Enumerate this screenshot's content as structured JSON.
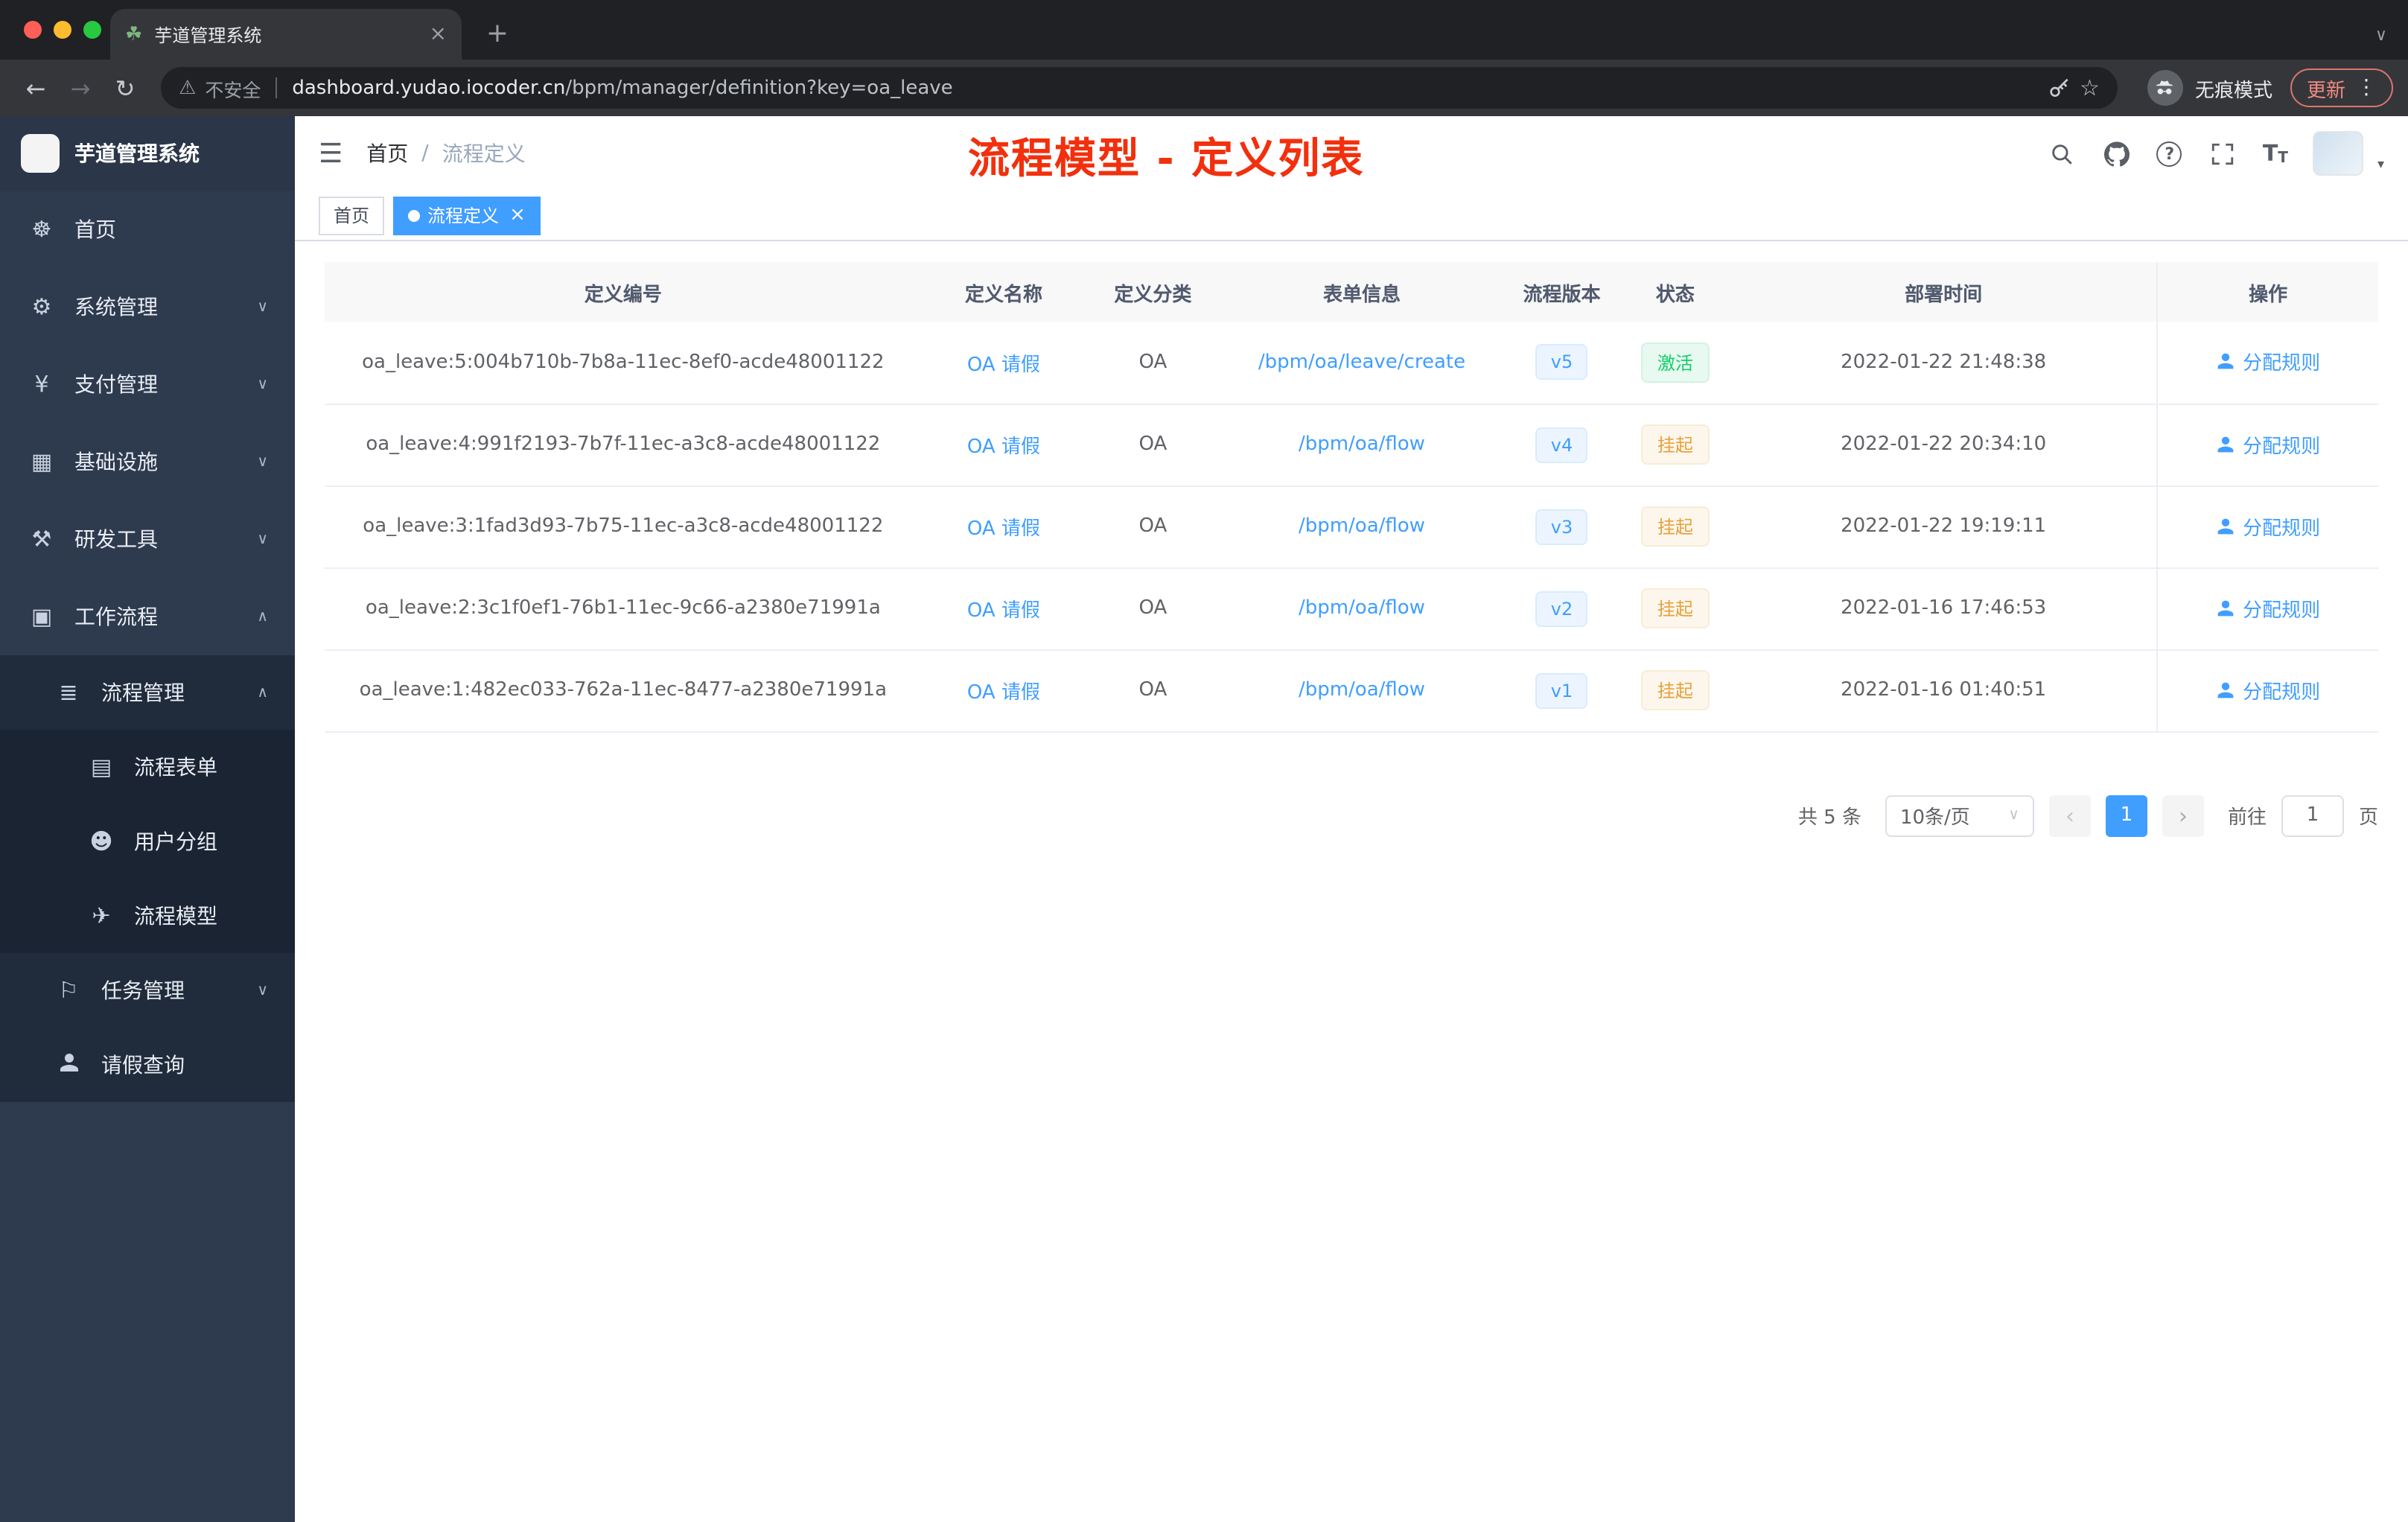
{
  "browser": {
    "tab_title": "芋道管理系统",
    "security_label": "不安全",
    "url_host": "dashboard.yudao.iocoder.cn",
    "url_path": "/bpm/manager/definition?key=oa_leave",
    "incognito_label": "无痕模式",
    "update_label": "更新"
  },
  "sidebar": {
    "app_title": "芋道管理系统",
    "items": [
      {
        "label": "首页",
        "icon": "☸"
      },
      {
        "label": "系统管理",
        "icon": "⚙"
      },
      {
        "label": "支付管理",
        "icon": "¥"
      },
      {
        "label": "基础设施",
        "icon": "▦"
      },
      {
        "label": "研发工具",
        "icon": "⚒"
      },
      {
        "label": "工作流程",
        "icon": "▣"
      },
      {
        "label": "流程管理",
        "icon": "≣"
      },
      {
        "label": "流程表单",
        "icon": "▤"
      },
      {
        "label": "用户分组",
        "icon": "☻"
      },
      {
        "label": "流程模型",
        "icon": "✈"
      },
      {
        "label": "任务管理",
        "icon": "⚐"
      },
      {
        "label": "请假查询",
        "icon": ""
      }
    ]
  },
  "header": {
    "breadcrumb_home": "首页",
    "breadcrumb_sep": "/",
    "breadcrumb_current": "流程定义",
    "annotation": "流程模型 - 定义列表"
  },
  "tags": {
    "home": "首页",
    "active": "流程定义"
  },
  "table": {
    "columns": [
      "定义编号",
      "定义名称",
      "定义分类",
      "表单信息",
      "流程版本",
      "状态",
      "部署时间",
      "操作"
    ],
    "rows": [
      {
        "id": "oa_leave:5:004b710b-7b8a-11ec-8ef0-acde48001122",
        "name": "OA 请假",
        "category": "OA",
        "form": "/bpm/oa/leave/create",
        "version": "v5",
        "status": "激活",
        "time": "2022-01-22 21:48:38",
        "action": "分配规则"
      },
      {
        "id": "oa_leave:4:991f2193-7b7f-11ec-a3c8-acde48001122",
        "name": "OA 请假",
        "category": "OA",
        "form": "/bpm/oa/flow",
        "version": "v4",
        "status": "挂起",
        "time": "2022-01-22 20:34:10",
        "action": "分配规则"
      },
      {
        "id": "oa_leave:3:1fad3d93-7b75-11ec-a3c8-acde48001122",
        "name": "OA 请假",
        "category": "OA",
        "form": "/bpm/oa/flow",
        "version": "v3",
        "status": "挂起",
        "time": "2022-01-22 19:19:11",
        "action": "分配规则"
      },
      {
        "id": "oa_leave:2:3c1f0ef1-76b1-11ec-9c66-a2380e71991a",
        "name": "OA 请假",
        "category": "OA",
        "form": "/bpm/oa/flow",
        "version": "v2",
        "status": "挂起",
        "time": "2022-01-16 17:46:53",
        "action": "分配规则"
      },
      {
        "id": "oa_leave:1:482ec033-762a-11ec-8477-a2380e71991a",
        "name": "OA 请假",
        "category": "OA",
        "form": "/bpm/oa/flow",
        "version": "v1",
        "status": "挂起",
        "time": "2022-01-16 01:40:51",
        "action": "分配规则"
      }
    ]
  },
  "pagination": {
    "total": "共 5 条",
    "page_size": "10条/页",
    "current_page": "1",
    "goto_label": "前往",
    "goto_value": "1",
    "goto_suffix": "页"
  },
  "icons": {
    "favicon": "☘",
    "close": "×",
    "plus": "+",
    "chevron_down": "∨",
    "chevron_up": "∧",
    "chevron_left": "‹",
    "chevron_right": "›",
    "back": "←",
    "forward": "→",
    "reload": "↻",
    "warning": "⚠",
    "star": "☆",
    "kebab": "⋮",
    "hamburger": "☰",
    "question": "?",
    "font_size_big": "T",
    "font_size_small": "T",
    "caret_down": "▾"
  },
  "colors": {
    "accent_blue": "#409eff",
    "status_active_green": "#13ce66",
    "status_suspend_orange": "#e6a23c",
    "annotation_red": "#f2300d",
    "sidebar_bg": "#2e3a4e"
  }
}
